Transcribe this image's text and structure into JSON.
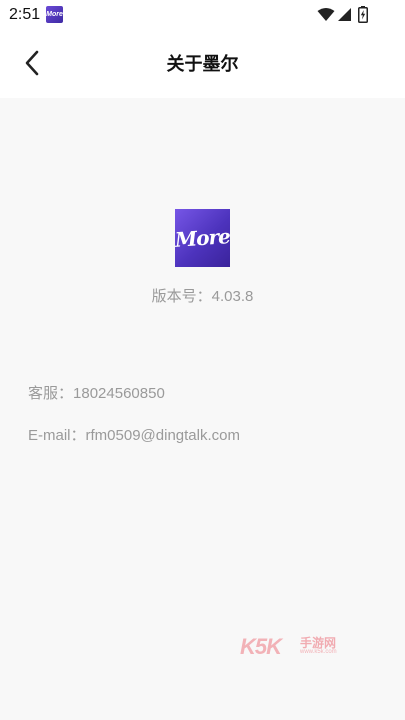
{
  "status_bar": {
    "time": "2:51",
    "app_icon_text": "More",
    "icons": [
      "wifi-icon",
      "signal-icon",
      "battery-icon"
    ]
  },
  "header": {
    "title": "关于墨尔",
    "back_icon": "chevron-left-icon"
  },
  "about": {
    "logo_text": "More",
    "version_label": "版本号：",
    "version_value": "4.03.8",
    "service_label": "客服：",
    "service_value": "18024560850",
    "email_label": "E-mail：",
    "email_value": "rfm0509@dingtalk.com"
  },
  "watermark": {
    "letters": "K5K",
    "text": "手游网",
    "url": "www.k5k.com"
  },
  "colors": {
    "logo_gradient_start": "#7656e6",
    "logo_gradient_end": "#3a239b",
    "muted_text": "#9a9a9a",
    "background": "#f8f8f8",
    "watermark": "#ec7882"
  }
}
